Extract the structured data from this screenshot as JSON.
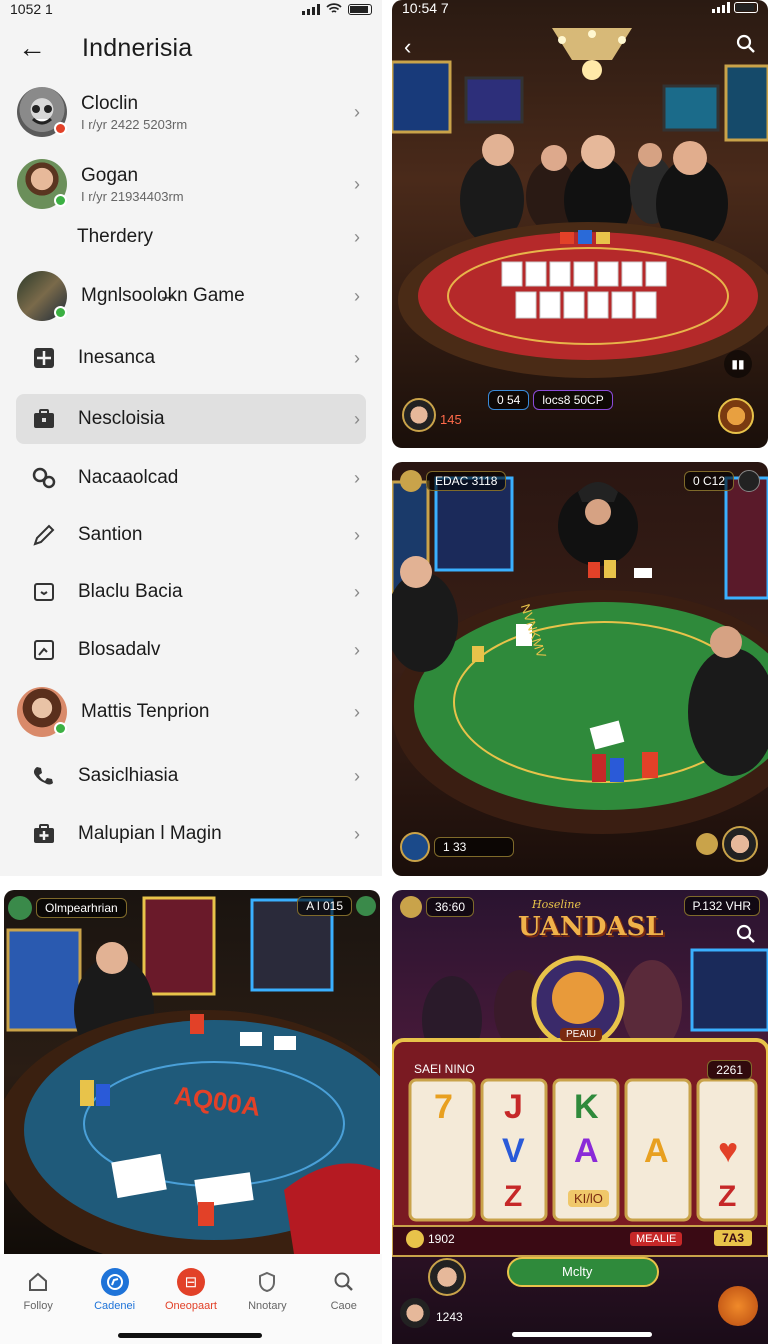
{
  "left_panel": {
    "status_time": "1052 1",
    "title": "Indnerisia",
    "rows": [
      {
        "label": "Cloclin",
        "sub": "I r/yr 2422 5203rm"
      },
      {
        "label": "Gogan",
        "sub": "I r/yr 21934403rm"
      },
      {
        "label": "Therdery",
        "sub": ""
      },
      {
        "label": "Mgnlsoolo̶kn Game",
        "sub": ""
      },
      {
        "label": "Inesanca",
        "sub": ""
      },
      {
        "label": "Nescloisia",
        "sub": ""
      },
      {
        "label": "Nacaaolcad",
        "sub": ""
      },
      {
        "label": "Santion",
        "sub": ""
      },
      {
        "label": "Blaclu Bacia",
        "sub": ""
      },
      {
        "label": "Blosadalv",
        "sub": ""
      },
      {
        "label": "Mattis Tenprion",
        "sub": ""
      },
      {
        "label": "Sasiclhiasia",
        "sub": ""
      },
      {
        "label": "Malupian l Magin",
        "sub": ""
      }
    ]
  },
  "poker_tile": {
    "status_time": "10:54 7",
    "pot": "0 54",
    "info": "locs8 50CP",
    "chips": "145"
  },
  "green_table_tile": {
    "top_left": "EDAC 3118",
    "top_right": "0 C12",
    "chips": "1 33",
    "table_text": "NVNKMV"
  },
  "blue_table_tile": {
    "top_left": "Olmpearhrian",
    "top_right": "A l 015",
    "table_text": "AQ00A"
  },
  "slots_tile": {
    "top_left": "36:60",
    "brand_small": "Hoseline",
    "brand": "UANDASL",
    "top_right": "P.132 VHR",
    "game_name": "SAEI NINO",
    "counter": "2261",
    "emblem_label": "PEAIU",
    "symbols": [
      "7",
      "J",
      "K",
      "V",
      "A",
      "♥",
      "Z",
      "A",
      "Z"
    ],
    "credits": "1902",
    "bet": "MEALIE",
    "win": "7A3",
    "center_label": "KI/lO",
    "button": "Mclty",
    "player_value": "1243"
  },
  "bottom_nav": [
    {
      "label": "Folloy",
      "icon": "home-icon"
    },
    {
      "label": "Cadenei",
      "icon": "compass-icon"
    },
    {
      "label": "Oneopaart",
      "icon": "game-icon"
    },
    {
      "label": "Nnotary",
      "icon": "shield-icon"
    },
    {
      "label": "Caoe",
      "icon": "search-icon"
    }
  ],
  "colors": {
    "accent_blue": "#1e73d8",
    "accent_red": "#e24128",
    "felt_green": "#2f8a3b",
    "felt_red": "#b5292a",
    "felt_blue": "#1f5a7a"
  }
}
